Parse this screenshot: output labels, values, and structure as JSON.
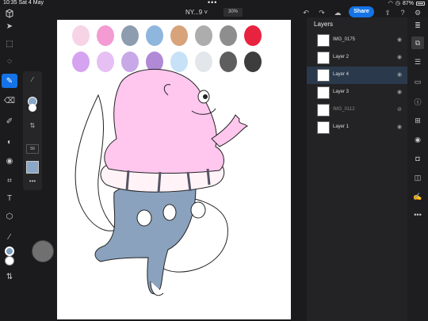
{
  "status": {
    "time": "10:35",
    "date": "Sat 4 May",
    "battery": "87%"
  },
  "topbar": {
    "doc_title": "NY...9 ˅",
    "zoom": "30%",
    "share_label": "Share",
    "undo_icon": "undo-icon",
    "redo_icon": "redo-icon"
  },
  "brush_panel": {
    "size": "59"
  },
  "layers": {
    "title": "Layers",
    "items": [
      {
        "name": "IMG_0175",
        "visible": true,
        "selected": false
      },
      {
        "name": "Layer 2",
        "visible": true,
        "selected": false
      },
      {
        "name": "Layer 4",
        "visible": true,
        "selected": true
      },
      {
        "name": "Layer 3",
        "visible": true,
        "selected": false
      },
      {
        "name": "IMG_0112",
        "visible": false,
        "selected": false
      },
      {
        "name": "Layer 1",
        "visible": true,
        "selected": false
      }
    ]
  },
  "palette": [
    "#f7d3e6",
    "#f39bd2",
    "#8e9cb0",
    "#8fb6dd",
    "#d7a37a",
    "#adadad",
    "#8e8e8e",
    "#e8233f",
    "#d6a3f0",
    "#e6bff3",
    "#c9a8e8",
    "#b08ad6",
    "#c7e2f7",
    "#e3e6ea",
    "#5e5e5e",
    "#3d3d3d"
  ],
  "colors": {
    "accent": "#1473e6",
    "body_pink": "#ffc6ee",
    "pants_blue": "#8aa2bd"
  }
}
